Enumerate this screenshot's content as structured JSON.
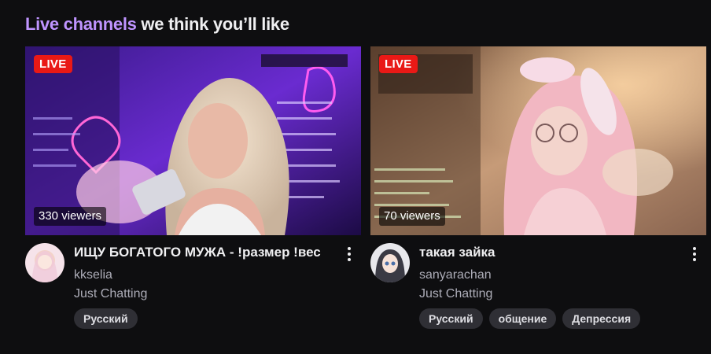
{
  "section": {
    "title_accent": "Live channels",
    "title_rest": " we think you’ll like"
  },
  "cards": [
    {
      "live_label": "LIVE",
      "viewers": "330 viewers",
      "title": "ИЩУ БОГАТОГО МУЖА - !размер !вес",
      "channel": "kkselia",
      "category": "Just Chatting",
      "tags": [
        "Русский"
      ]
    },
    {
      "live_label": "LIVE",
      "viewers": "70 viewers",
      "title": "такая зайка",
      "channel": "sanyarachan",
      "category": "Just Chatting",
      "tags": [
        "Русский",
        "общение",
        "Депрессия"
      ]
    }
  ],
  "colors": {
    "accent": "#bf94ff",
    "live": "#e91916",
    "background": "#0e0e10",
    "tag_bg": "#2f2f35"
  }
}
